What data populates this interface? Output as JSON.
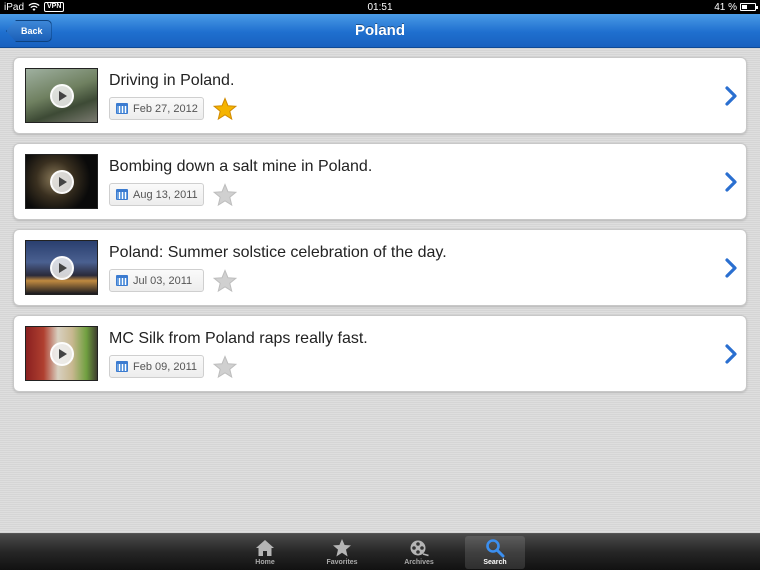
{
  "status_bar": {
    "device": "iPad",
    "vpn": "VPN",
    "time": "01:51",
    "battery": "41 %"
  },
  "nav": {
    "title": "Poland",
    "back_label": "Back"
  },
  "videos": [
    {
      "title": "Driving in Poland.",
      "date": "Feb 27, 2012",
      "favorite": true
    },
    {
      "title": "Bombing down a salt mine in Poland.",
      "date": "Aug 13, 2011",
      "favorite": false
    },
    {
      "title": "Poland: Summer solstice celebration of the day.",
      "date": "Jul 03, 2011",
      "favorite": false
    },
    {
      "title": "MC Silk from Poland raps really fast.",
      "date": "Feb 09, 2011",
      "favorite": false
    }
  ],
  "tabs": [
    {
      "label": "Home",
      "icon": "home-icon",
      "active": false
    },
    {
      "label": "Favorites",
      "icon": "star-icon",
      "active": false
    },
    {
      "label": "Archives",
      "icon": "film-reel-icon",
      "active": false
    },
    {
      "label": "Search",
      "icon": "search-icon",
      "active": true
    }
  ],
  "colors": {
    "nav_blue": "#1f6fcf",
    "star_gold": "#f5b400",
    "star_gray": "#c8c8c8",
    "chevron_blue": "#2a6fd0"
  }
}
